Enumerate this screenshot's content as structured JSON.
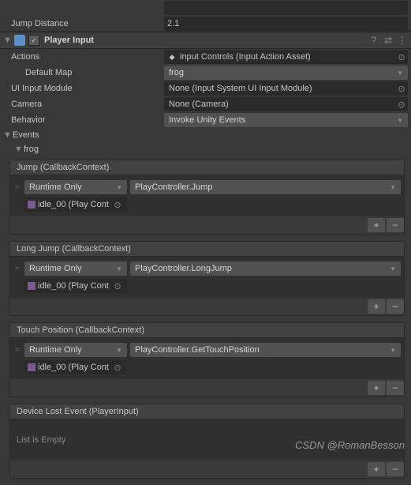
{
  "topRows": [
    {
      "label": "",
      "value": ""
    },
    {
      "label": "Jump Distance",
      "value": "2.1"
    }
  ],
  "component": {
    "title": "Player Input",
    "enabled": "✓"
  },
  "props": {
    "actions": {
      "label": "Actions",
      "value": "input Controls (Input Action Asset)"
    },
    "defaultMap": {
      "label": "Default Map",
      "value": "frog"
    },
    "uiInputModule": {
      "label": "UI Input Module",
      "value": "None (Input System UI Input Module)"
    },
    "camera": {
      "label": "Camera",
      "value": "None (Camera)"
    },
    "behavior": {
      "label": "Behavior",
      "value": "Invoke Unity Events"
    }
  },
  "eventsLabel": "Events",
  "eventsSub": "frog",
  "events": [
    {
      "title": "Jump (CallbackContext)",
      "runtime": "Runtime Only",
      "method": "PlayController.Jump",
      "target": "idle_00 (Play Cont"
    },
    {
      "title": "Long Jump (CallbackContext)",
      "runtime": "Runtime Only",
      "method": "PlayController.LongJump",
      "target": "idle_00 (Play Cont"
    },
    {
      "title": "Touch Position (CallbackContext)",
      "runtime": "Runtime Only",
      "method": "PlayController.GetTouchPosition",
      "target": "idle_00 (Play Cont"
    }
  ],
  "deviceLost": {
    "title": "Device Lost Event (PlayerInput)",
    "empty": "List is Empty"
  },
  "buttons": {
    "plus": "+",
    "minus": "−"
  },
  "watermark": "CSDN @RomanBesson"
}
